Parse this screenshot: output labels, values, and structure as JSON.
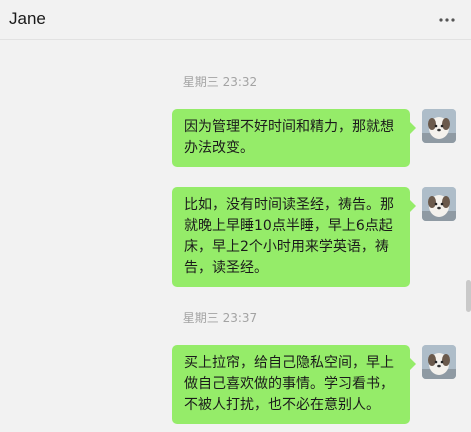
{
  "header": {
    "contact_name": "Jane",
    "more_icon": "more-dots-icon"
  },
  "colors": {
    "bubble_self": "#95ec69",
    "background": "#f2f2f2",
    "timestamp_text": "#a3a3a3"
  },
  "chat": {
    "timestamps": [
      "星期三 23:32",
      "星期三 23:37"
    ],
    "messages": [
      {
        "sender": "self",
        "text": "因为管理不好时间和精力，那就想办法改变。"
      },
      {
        "sender": "self",
        "text": "比如，没有时间读圣经，祷告。那就晚上早睡10点半睡，早上6点起床，早上2个小时用来学英语，祷告，读圣经。"
      },
      {
        "sender": "self",
        "text": "买上拉帘，给自己隐私空间，早上做自己喜欢做的事情。学习看书，不被人打扰，也不必在意别人。"
      }
    ]
  }
}
